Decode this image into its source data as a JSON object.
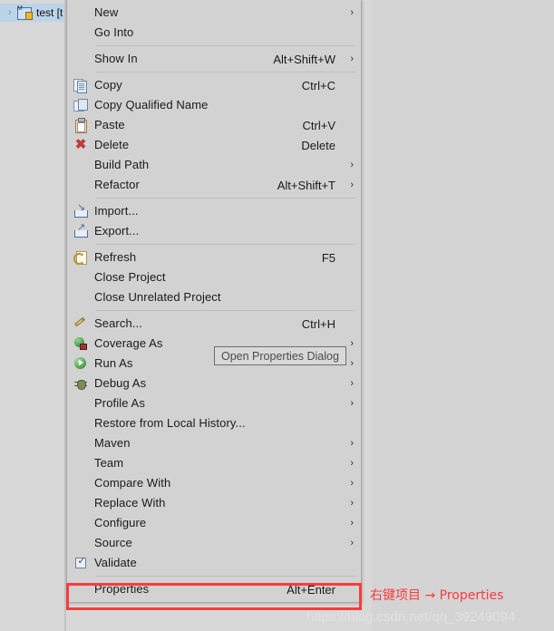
{
  "workbench": {
    "tree": {
      "row": {
        "label": "test [t",
        "expand_arrow": "›",
        "icon": "maven-java-project-icon",
        "selected": true
      }
    }
  },
  "context_menu": {
    "items": [
      {
        "type": "item",
        "label": "New",
        "accel": "",
        "arrow": "›",
        "icon": ""
      },
      {
        "type": "item",
        "label": "Go Into",
        "accel": "",
        "arrow": "",
        "icon": ""
      },
      {
        "type": "separator"
      },
      {
        "type": "item",
        "label": "Show In",
        "accel": "Alt+Shift+W",
        "arrow": "›",
        "icon": ""
      },
      {
        "type": "separator"
      },
      {
        "type": "item",
        "label": "Copy",
        "accel": "Ctrl+C",
        "arrow": "",
        "icon": "copy-icon"
      },
      {
        "type": "item",
        "label": "Copy Qualified Name",
        "accel": "",
        "arrow": "",
        "icon": "copy-qualified-name-icon"
      },
      {
        "type": "item",
        "label": "Paste",
        "accel": "Ctrl+V",
        "arrow": "",
        "icon": "paste-icon"
      },
      {
        "type": "item",
        "label": "Delete",
        "accel": "Delete",
        "arrow": "",
        "icon": "delete-icon"
      },
      {
        "type": "item",
        "label": "Build Path",
        "accel": "",
        "arrow": "›",
        "icon": ""
      },
      {
        "type": "item",
        "label": "Refactor",
        "accel": "Alt+Shift+T",
        "arrow": "›",
        "icon": ""
      },
      {
        "type": "separator"
      },
      {
        "type": "item",
        "label": "Import...",
        "accel": "",
        "arrow": "",
        "icon": "import-icon"
      },
      {
        "type": "item",
        "label": "Export...",
        "accel": "",
        "arrow": "",
        "icon": "export-icon"
      },
      {
        "type": "separator"
      },
      {
        "type": "item",
        "label": "Refresh",
        "accel": "F5",
        "arrow": "",
        "icon": "refresh-icon"
      },
      {
        "type": "item",
        "label": "Close Project",
        "accel": "",
        "arrow": "",
        "icon": ""
      },
      {
        "type": "item",
        "label": "Close Unrelated Project",
        "accel": "",
        "arrow": "",
        "icon": ""
      },
      {
        "type": "separator"
      },
      {
        "type": "item",
        "label": "Search...",
        "accel": "Ctrl+H",
        "arrow": "",
        "icon": "search-icon"
      },
      {
        "type": "item",
        "label": "Coverage As",
        "accel": "",
        "arrow": "›",
        "icon": "coverage-icon"
      },
      {
        "type": "item",
        "label": "Run As",
        "accel": "",
        "arrow": "›",
        "icon": "run-icon"
      },
      {
        "type": "item",
        "label": "Debug As",
        "accel": "",
        "arrow": "›",
        "icon": "debug-icon"
      },
      {
        "type": "item",
        "label": "Profile As",
        "accel": "",
        "arrow": "›",
        "icon": ""
      },
      {
        "type": "item",
        "label": "Restore from Local History...",
        "accel": "",
        "arrow": "",
        "icon": ""
      },
      {
        "type": "item",
        "label": "Maven",
        "accel": "",
        "arrow": "›",
        "icon": ""
      },
      {
        "type": "item",
        "label": "Team",
        "accel": "",
        "arrow": "›",
        "icon": ""
      },
      {
        "type": "item",
        "label": "Compare With",
        "accel": "",
        "arrow": "›",
        "icon": ""
      },
      {
        "type": "item",
        "label": "Replace With",
        "accel": "",
        "arrow": "›",
        "icon": ""
      },
      {
        "type": "item",
        "label": "Configure",
        "accel": "",
        "arrow": "›",
        "icon": ""
      },
      {
        "type": "item",
        "label": "Source",
        "accel": "",
        "arrow": "›",
        "icon": ""
      },
      {
        "type": "item",
        "label": "Validate",
        "accel": "",
        "arrow": "",
        "icon": "checkbox-checked-icon",
        "checked": true
      },
      {
        "type": "separator"
      },
      {
        "type": "item",
        "label": "Properties",
        "accel": "Alt+Enter",
        "arrow": "",
        "icon": "",
        "highlighted": true
      }
    ]
  },
  "tooltip": {
    "text": "Open Properties Dialog"
  },
  "annotation": {
    "text": "右键项目 → Properties",
    "color": "#fb3b3b"
  },
  "watermark": {
    "text": "https://blog.csdn.net/qq_39249094"
  },
  "colors": {
    "menu_background": "#d2d2d2",
    "menu_border": "#a8a8a8",
    "selection": "#bcd4ea",
    "highlight_red": "#fb3b3b",
    "workbench_background": "#d4d4d4"
  }
}
